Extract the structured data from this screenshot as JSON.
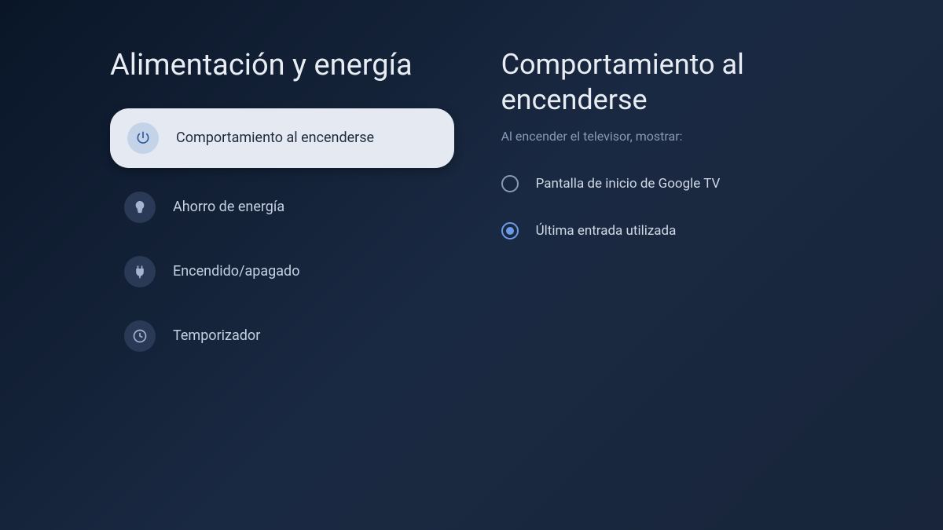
{
  "leftPanel": {
    "title": "Alimentación y energía",
    "menu": [
      {
        "icon": "power-icon",
        "label": "Comportamiento al encenderse",
        "selected": true
      },
      {
        "icon": "bulb-icon",
        "label": "Ahorro de energía",
        "selected": false
      },
      {
        "icon": "plug-icon",
        "label": "Encendido/apagado",
        "selected": false
      },
      {
        "icon": "clock-icon",
        "label": "Temporizador",
        "selected": false
      }
    ]
  },
  "rightPanel": {
    "title": "Comportamiento al encenderse",
    "subtitle": "Al encender el televisor, mostrar:",
    "options": [
      {
        "label": "Pantalla de inicio de Google TV",
        "checked": false
      },
      {
        "label": "Última entrada utilizada",
        "checked": true
      }
    ]
  }
}
